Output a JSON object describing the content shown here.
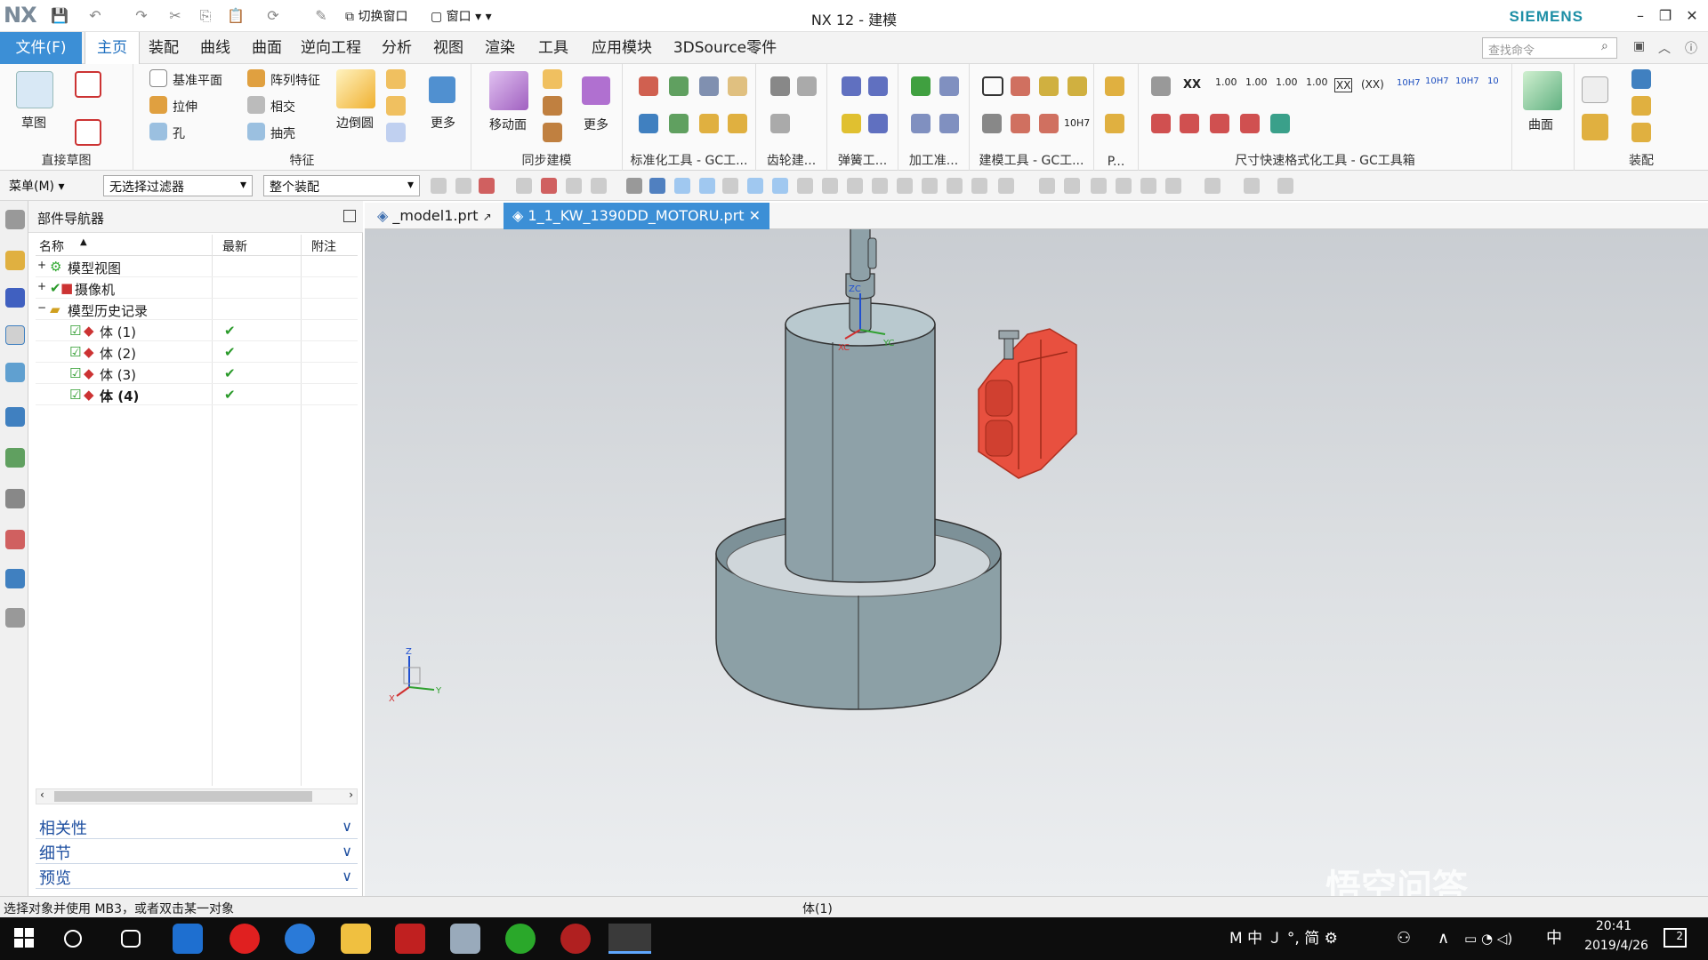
{
  "app": {
    "logo": "NX",
    "window_title": "NX 12 - 建模",
    "brand": "SIEMENS",
    "brand_color": "#1e8fa6",
    "accent_color": "#3c8fd6"
  },
  "menu": {
    "file_label": "文件(F)",
    "tabs": [
      "主页",
      "装配",
      "曲线",
      "曲面",
      "逆向工程",
      "分析",
      "视图",
      "渲染",
      "工具",
      "应用模块",
      "3DSource零件库"
    ],
    "active_tab": "主页",
    "search_placeholder": "查找命令"
  },
  "ribbon": {
    "groups": {
      "direct_sketch": "直接草图",
      "feature": "特征",
      "sync_model": "同步建模",
      "std_tools": "标准化工具 - GC工...",
      "gear": "齿轮建...",
      "spring": "弹簧工...",
      "machining": "加工准...",
      "modeling_tools": "建模工具 - GC工...",
      "p": "P...",
      "dim_tools": "尺寸快速格式化工具 - GC工具箱",
      "assembly": "装配"
    },
    "buttons": {
      "sketch": "草图",
      "datum_plane": "基准平面",
      "array_feature": "阵列特征",
      "extrude": "拉伸",
      "intersect": "相交",
      "hole": "孔",
      "shell": "抽壳",
      "edge_blend": "边倒圆",
      "more1": "更多",
      "move_face": "移动面",
      "more2": "更多",
      "surface": "曲面"
    },
    "dim_labels": [
      "XX",
      "1.00",
      "1.00",
      "1.00",
      "1.00",
      "XX",
      "(XX)",
      "10H7",
      "10H7",
      "10H7",
      "10"
    ],
    "tol_label": "10H7"
  },
  "toolbar2": {
    "menu_label": "菜单(M)",
    "filter_value": "无选择过滤器",
    "scope_value": "整个装配"
  },
  "navigator": {
    "title": "部件导航器",
    "columns": {
      "name": "名称",
      "latest": "最新",
      "note": "附注"
    },
    "rows": [
      {
        "label": "模型视图",
        "expander": "+",
        "latest": ""
      },
      {
        "label": "摄像机",
        "expander": "+",
        "latest": ""
      },
      {
        "label": "模型历史记录",
        "expander": "−",
        "latest": ""
      },
      {
        "label": "体 (1)",
        "expander": "",
        "latest": "✔"
      },
      {
        "label": "体 (2)",
        "expander": "",
        "latest": "✔"
      },
      {
        "label": "体 (3)",
        "expander": "",
        "latest": "✔"
      },
      {
        "label": "体 (4)",
        "expander": "",
        "latest": "✔"
      }
    ],
    "panels": [
      "相关性",
      "细节",
      "预览"
    ]
  },
  "file_tabs": [
    {
      "label": "_model1.prt"
    },
    {
      "label": "1_1_KW_1390DD_MOTORU.prt",
      "active": true
    }
  ],
  "viewport": {
    "axis_labels": {
      "zc": "ZC",
      "xc": "XC",
      "yc": "YC",
      "z": "Z",
      "x": "X",
      "y": "Y"
    },
    "body_color": "#8a9ca3",
    "part_color": "#e8503f"
  },
  "status": {
    "message": "选择对象并使用 MB3，或者双击某一对象",
    "selection": "体(1)"
  },
  "taskbar": {
    "ime": [
      "M",
      "中",
      "Ｊ",
      "°,",
      "简"
    ],
    "input_lang": "中",
    "time": "20:41",
    "date": "2019/4/26",
    "notifications": "2"
  },
  "watermark": "悟空问答"
}
